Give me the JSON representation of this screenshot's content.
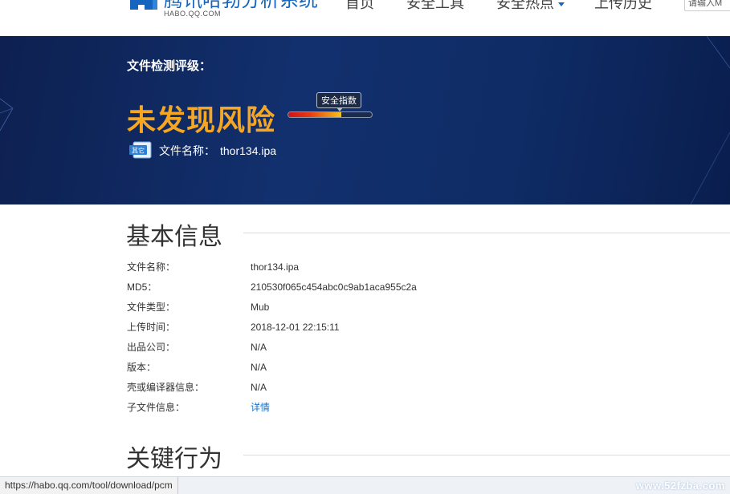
{
  "header": {
    "logo_text": "腾讯哈勃分析系统",
    "logo_sub": "HABO.QQ.COM",
    "nav": [
      {
        "label": "首页"
      },
      {
        "label": "安全工具"
      },
      {
        "label": "安全热点"
      },
      {
        "label": "上传历史"
      }
    ],
    "search_placeholder": "请输入M"
  },
  "banner": {
    "grade_label": "文件检测评级：",
    "risk_text": "未发现风险",
    "safety_label": "安全指数",
    "safety_level": 0.63,
    "file_icon_text": "其它",
    "file_name_label": "文件名称：",
    "file_name": "thor134.ipa"
  },
  "basic_info": {
    "title": "基本信息",
    "rows": [
      {
        "key": "文件名称：",
        "value": "thor134.ipa"
      },
      {
        "key": "MD5：",
        "value": "210530f065c454abc0c9ab1aca955c2a"
      },
      {
        "key": "文件类型：",
        "value": "Mub"
      },
      {
        "key": "上传时间：",
        "value": "2018-12-01 22:15:11"
      },
      {
        "key": "出品公司：",
        "value": "N/A"
      },
      {
        "key": "版本：",
        "value": "N/A"
      },
      {
        "key": "壳或编译器信息：",
        "value": "N/A"
      },
      {
        "key": "子文件信息：",
        "value": "详情"
      }
    ]
  },
  "behavior": {
    "title": "关键行为"
  },
  "statusbar": {
    "url": "https://habo.qq.com/tool/download/pcm",
    "watermark": "www.52fzba.com"
  }
}
